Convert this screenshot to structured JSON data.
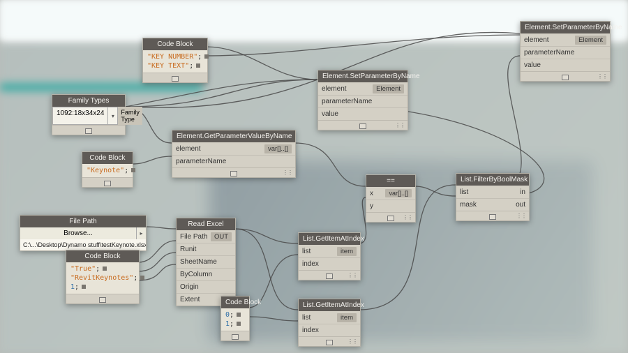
{
  "nodes": {
    "cb1": {
      "title": "Code Block",
      "lines": [
        {
          "text": "\"KEY NUMBER\"",
          "cls": "str",
          "sc": ";"
        },
        {
          "text": "\"KEY TEXT\"",
          "cls": "str",
          "sc": ";"
        }
      ]
    },
    "familyTypes": {
      "title": "Family Types",
      "value": "1092:18x34x24",
      "outLabel": "Family Type"
    },
    "cb2": {
      "title": "Code Block",
      "lines": [
        {
          "text": "\"Keynote\"",
          "cls": "str",
          "sc": ";"
        }
      ]
    },
    "getParam": {
      "title": "Element.GetParameterValueByName",
      "ports": [
        "element",
        "parameterName"
      ],
      "out": "var[]..[]"
    },
    "setParam1": {
      "title": "Element.SetParameterByName",
      "ports": [
        "element",
        "parameterName",
        "value"
      ],
      "out": "Element"
    },
    "setParam2": {
      "title": "Element.SetParameterByName",
      "ports": [
        "element",
        "parameterName",
        "value"
      ],
      "out": "Element"
    },
    "filePath": {
      "title": "File Path",
      "browse": "Browse...",
      "path": "C:\\...\\Desktop\\Dynamo stuff\\testKeynote.xlsx"
    },
    "cb3": {
      "title": "Code Block",
      "lines": [
        {
          "text": "\"True\"",
          "cls": "str",
          "sc": ";"
        },
        {
          "text": "\"RevitKeynotes\"",
          "cls": "str",
          "sc": ";"
        },
        {
          "text": "1",
          "cls": "num",
          "sc": ";"
        }
      ]
    },
    "readExcel": {
      "title": "Read Excel",
      "ports": [
        "File Path",
        "Runit",
        "SheetName",
        "ByColumn",
        "Origin",
        "Extent"
      ],
      "out": "OUT"
    },
    "getItem1": {
      "title": "List.GetItemAtIndex",
      "ports": [
        "list",
        "index"
      ],
      "out": "item"
    },
    "getItem2": {
      "title": "List.GetItemAtIndex",
      "ports": [
        "list",
        "index"
      ],
      "out": "item"
    },
    "cb4": {
      "title": "Code Block",
      "lines": [
        {
          "text": "0",
          "cls": "num",
          "sc": ";"
        },
        {
          "text": "1",
          "cls": "num",
          "sc": ";"
        }
      ]
    },
    "equals": {
      "title": "==",
      "ports": [
        "x",
        "y"
      ],
      "out": "var[]..[]"
    },
    "filter": {
      "title": "List.FilterByBoolMask",
      "ports": [
        "list",
        "mask"
      ],
      "outs": [
        "in",
        "out"
      ]
    }
  }
}
